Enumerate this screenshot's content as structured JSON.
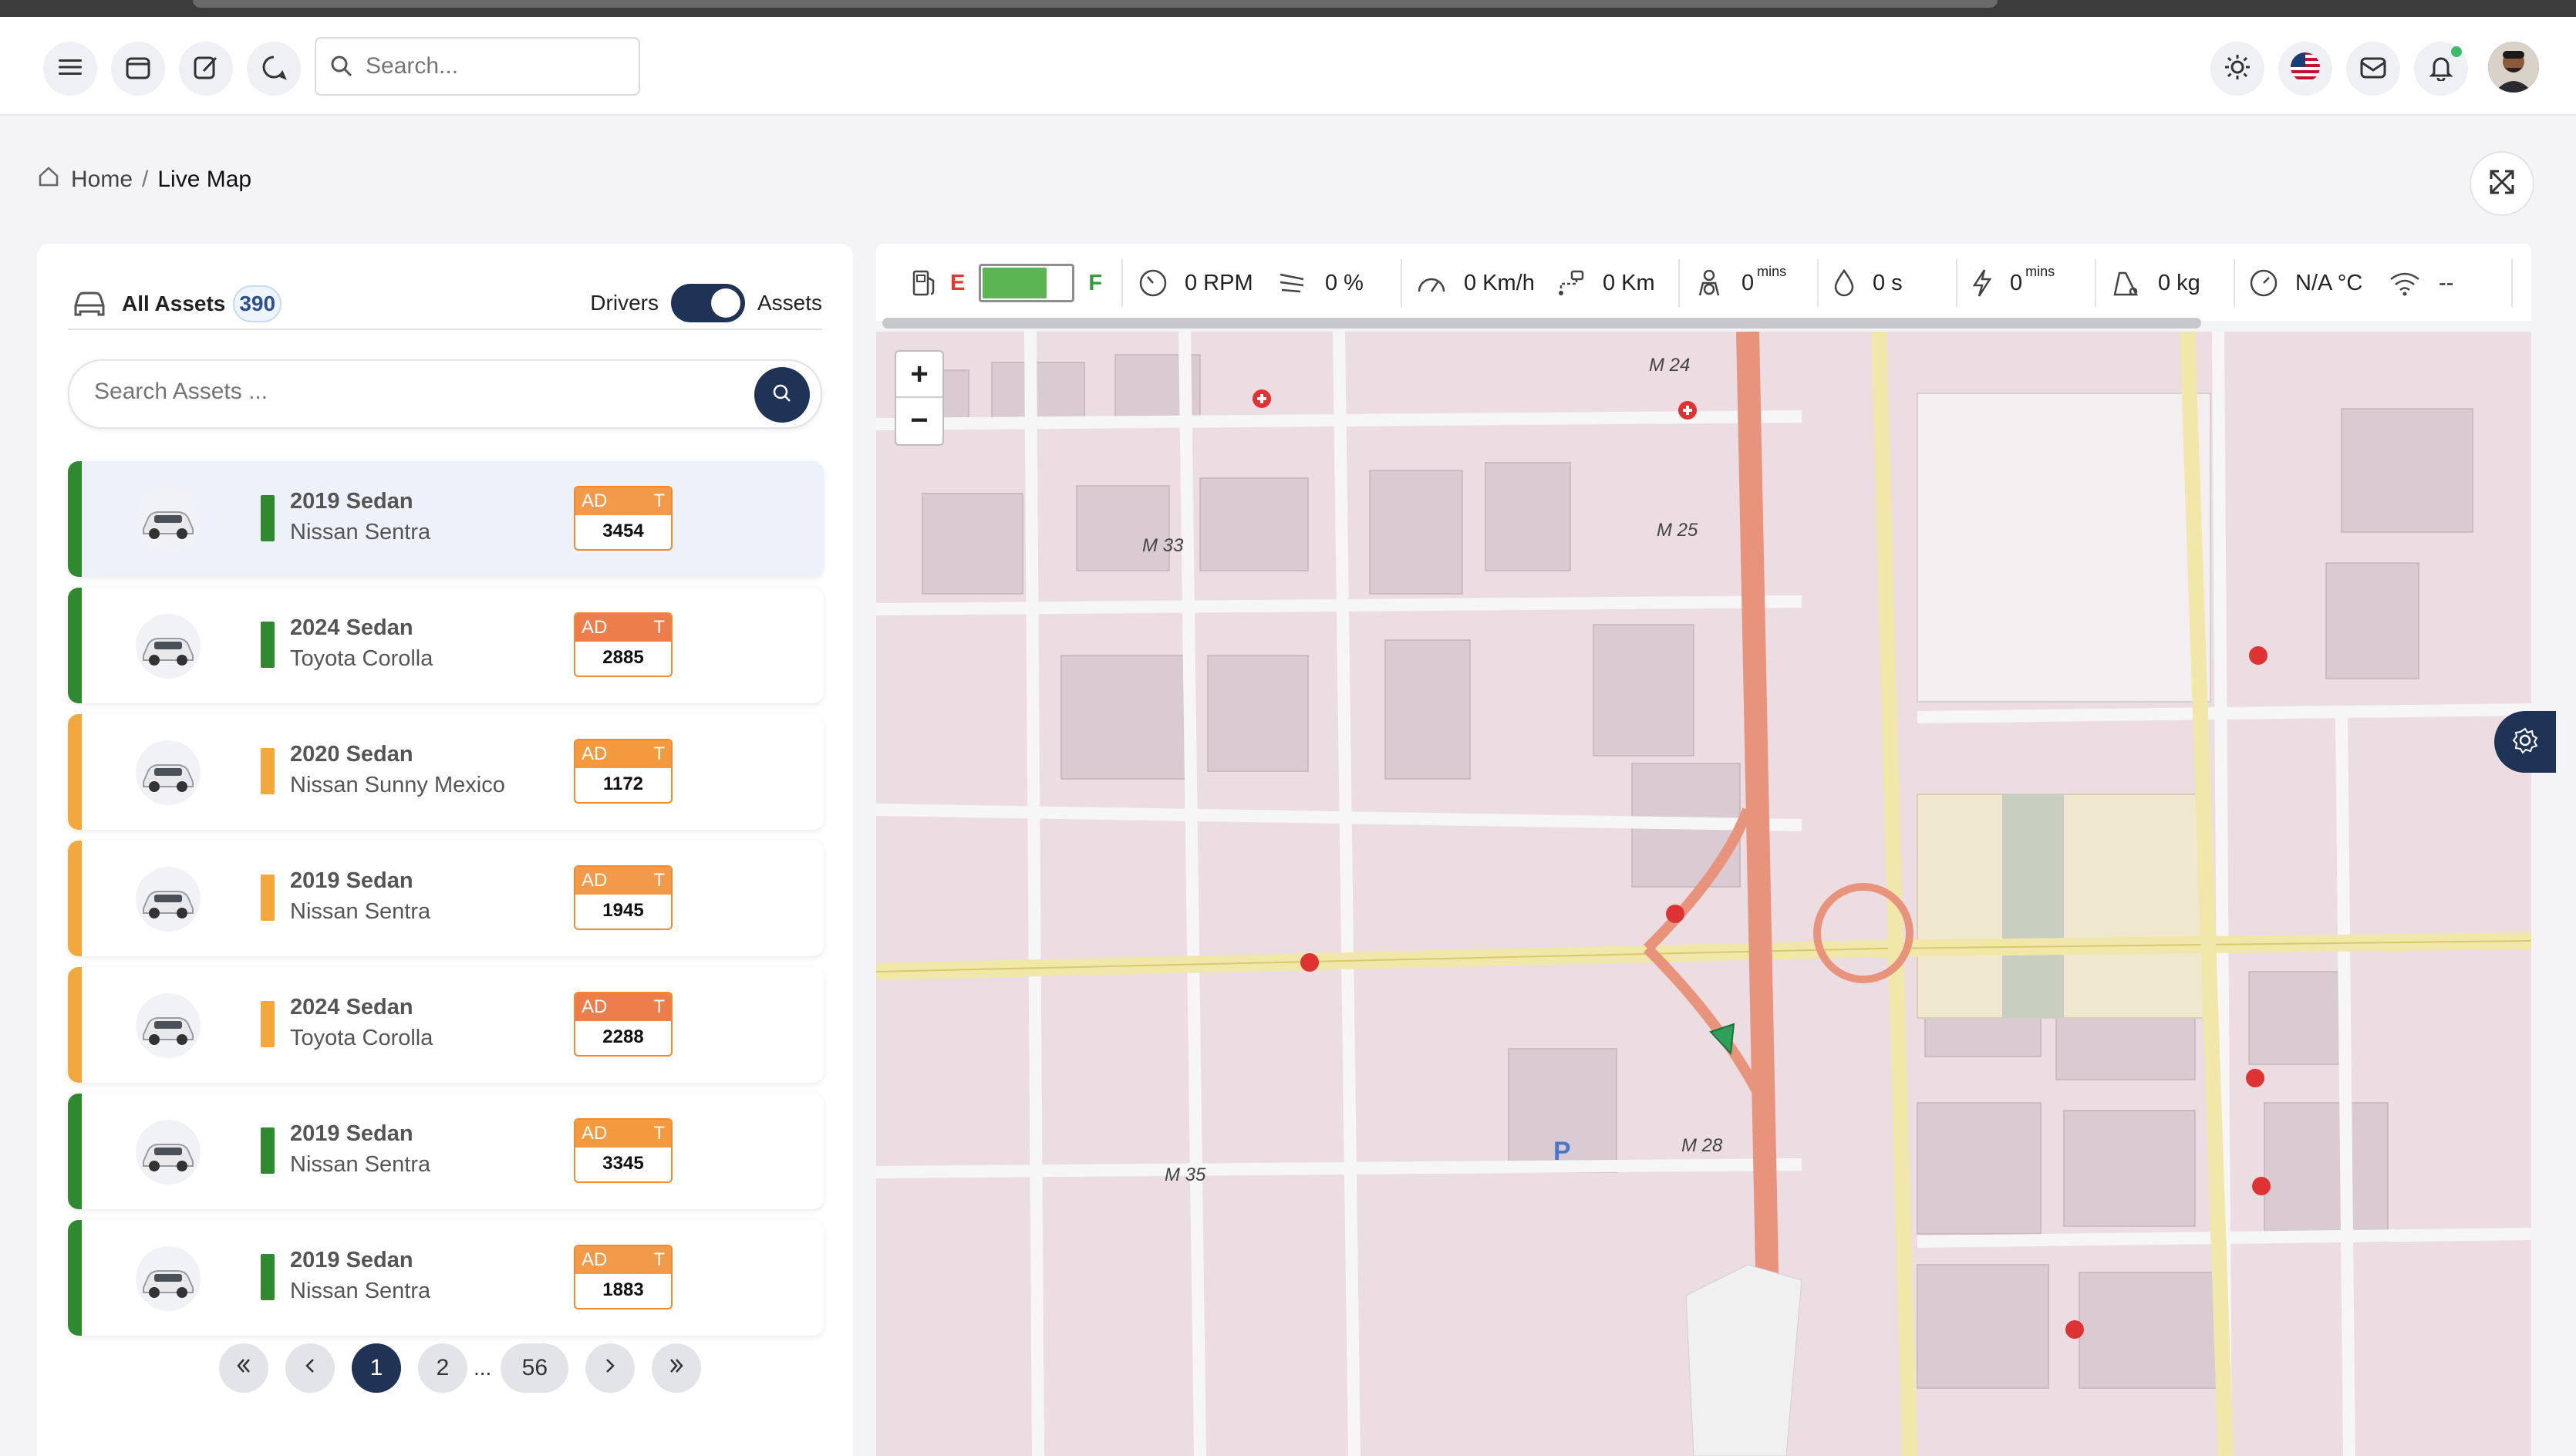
{
  "header": {
    "search_placeholder": "Search..."
  },
  "breadcrumb": {
    "home": "Home",
    "separator": "/",
    "current": "Live Map"
  },
  "panel": {
    "title": "All Assets",
    "count": "390",
    "toggle_left": "Drivers",
    "toggle_right": "Assets",
    "search_placeholder": "Search Assets ..."
  },
  "assets": [
    {
      "line1": "2019 Sedan",
      "line2": "Nissan Sentra",
      "plate_top": "AD",
      "plate_right": "T",
      "plate_number": "3454",
      "status_color": "#2f8a2f",
      "selected": true
    },
    {
      "line1": "2024 Sedan",
      "line2": "Toyota Corolla",
      "plate_top": "AD",
      "plate_right": "T",
      "plate_number": "2885",
      "status_color": "#2f8a2f",
      "selected": false
    },
    {
      "line1": "2020 Sedan",
      "line2": "Nissan Sunny Mexico",
      "plate_top": "AD",
      "plate_right": "T",
      "plate_number": "1172",
      "status_color": "#f3a83b",
      "selected": false
    },
    {
      "line1": "2019 Sedan",
      "line2": "Nissan Sentra",
      "plate_top": "AD",
      "plate_right": "T",
      "plate_number": "1945",
      "status_color": "#f3a83b",
      "selected": false
    },
    {
      "line1": "2024 Sedan",
      "line2": "Toyota Corolla",
      "plate_top": "AD",
      "plate_right": "T",
      "plate_number": "2288",
      "status_color": "#f3a83b",
      "selected": false
    },
    {
      "line1": "2019 Sedan",
      "line2": "Nissan Sentra",
      "plate_top": "AD",
      "plate_right": "T",
      "plate_number": "3345",
      "status_color": "#2f8a2f",
      "selected": false
    },
    {
      "line1": "2019 Sedan",
      "line2": "Nissan Sentra",
      "plate_top": "AD",
      "plate_right": "T",
      "plate_number": "1883",
      "status_color": "#2f8a2f",
      "selected": false
    }
  ],
  "pagination": {
    "pages": [
      "1",
      "2"
    ],
    "ellipsis": "...",
    "last": "56",
    "current": "1"
  },
  "stats": {
    "fuel_empty": "E",
    "fuel_full": "F",
    "fuel_level": 0.75,
    "rpm": "0 RPM",
    "throttle": "0 %",
    "speed": "0 Km/h",
    "distance": "0 Km",
    "idle": "0",
    "idle_unit": "mins",
    "fuel_time": "0 s",
    "power": "0",
    "power_unit": "mins",
    "load": "0 kg",
    "temperature": "N/A °C",
    "signal": "--"
  },
  "map": {
    "zoom_in": "+",
    "zoom_out": "−",
    "labels": [
      "M 24",
      "M 25",
      "M 33",
      "M 35",
      "M 28",
      "P"
    ]
  },
  "colors": {
    "primary": "#1f3356",
    "status_green": "#2f8a2f",
    "status_orange": "#f3a83b",
    "plate_orange": "#f08a2d"
  }
}
